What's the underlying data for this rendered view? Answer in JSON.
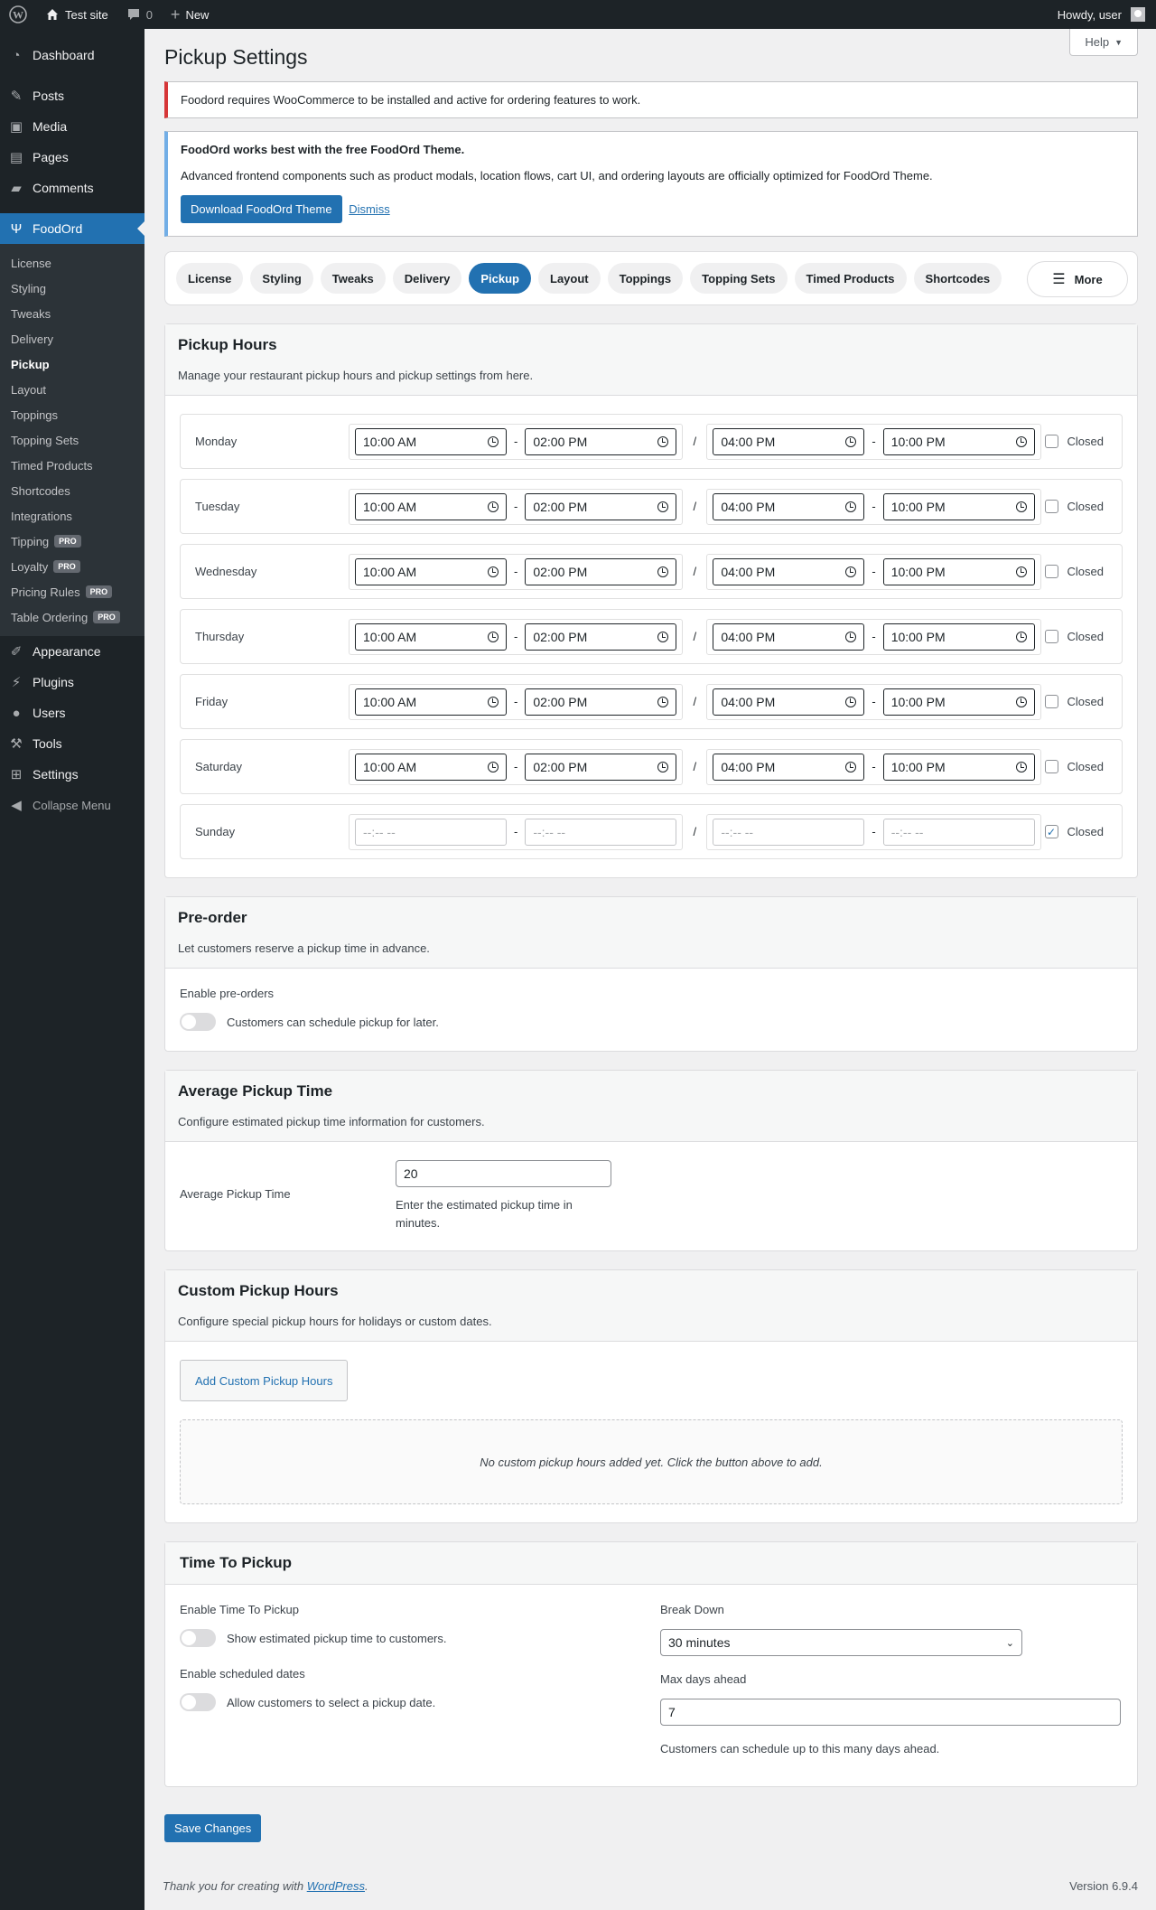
{
  "adminbar": {
    "site": "Test site",
    "comments": "0",
    "new": "New",
    "howdy": "Howdy, user"
  },
  "sidebar": {
    "dashboard": "Dashboard",
    "posts": "Posts",
    "media": "Media",
    "pages": "Pages",
    "comments": "Comments",
    "foodord": "FoodOrd",
    "submenu": [
      "License",
      "Styling",
      "Tweaks",
      "Delivery",
      "Pickup",
      "Layout",
      "Toppings",
      "Topping Sets",
      "Timed Products",
      "Shortcodes",
      "Integrations"
    ],
    "pro_items": [
      {
        "label": "Tipping",
        "badge": "PRO"
      },
      {
        "label": "Loyalty",
        "badge": "PRO"
      },
      {
        "label": "Pricing Rules",
        "badge": "PRO"
      },
      {
        "label": "Table Ordering",
        "badge": "PRO"
      }
    ],
    "appearance": "Appearance",
    "plugins": "Plugins",
    "users": "Users",
    "tools": "Tools",
    "settings": "Settings",
    "collapse": "Collapse Menu"
  },
  "help": "Help",
  "page_title": "Pickup Settings",
  "notice_error": "Foodord requires WooCommerce to be installed and active for ordering features to work.",
  "notice_info": {
    "title": "FoodOrd works best with the free FoodOrd Theme.",
    "text": "Advanced frontend components such as product modals, location flows, cart UI, and ordering layouts are officially optimized for FoodOrd Theme.",
    "button": "Download FoodOrd Theme",
    "dismiss": "Dismiss"
  },
  "tabs": [
    "License",
    "Styling",
    "Tweaks",
    "Delivery",
    "Pickup",
    "Layout",
    "Toppings",
    "Topping Sets",
    "Timed Products",
    "Shortcodes"
  ],
  "active_tab": "Pickup",
  "more": "More",
  "pickup_hours": {
    "title": "Pickup Hours",
    "desc": "Manage your restaurant pickup hours and pickup settings from here.",
    "closed_label": "Closed",
    "days": [
      {
        "name": "Monday",
        "s1": "10:00  AM",
        "e1": "02:00  PM",
        "s2": "04:00  PM",
        "e2": "10:00  PM",
        "closed": false
      },
      {
        "name": "Tuesday",
        "s1": "10:00  AM",
        "e1": "02:00  PM",
        "s2": "04:00  PM",
        "e2": "10:00  PM",
        "closed": false
      },
      {
        "name": "Wednesday",
        "s1": "10:00  AM",
        "e1": "02:00  PM",
        "s2": "04:00  PM",
        "e2": "10:00  PM",
        "closed": false
      },
      {
        "name": "Thursday",
        "s1": "10:00  AM",
        "e1": "02:00  PM",
        "s2": "04:00  PM",
        "e2": "10:00  PM",
        "closed": false
      },
      {
        "name": "Friday",
        "s1": "10:00  AM",
        "e1": "02:00  PM",
        "s2": "04:00  PM",
        "e2": "10:00  PM",
        "closed": false
      },
      {
        "name": "Saturday",
        "s1": "10:00  AM",
        "e1": "02:00  PM",
        "s2": "04:00  PM",
        "e2": "10:00  PM",
        "closed": false
      },
      {
        "name": "Sunday",
        "s1": "--:--  --",
        "e1": "--:--  --",
        "s2": "--:--  --",
        "e2": "--:--  --",
        "closed": true
      }
    ]
  },
  "preorder": {
    "title": "Pre-order",
    "desc": "Let customers reserve a pickup time in advance.",
    "label": "Enable pre-orders",
    "toggle_text": "Customers can schedule pickup for later.",
    "enabled": false
  },
  "avg_time": {
    "title": "Average Pickup Time",
    "desc": "Configure estimated pickup time information for customers.",
    "label": "Average Pickup Time",
    "value": "20",
    "help": "Enter the estimated pickup time in minutes."
  },
  "custom_hours": {
    "title": "Custom Pickup Hours",
    "desc": "Configure special pickup hours for holidays or custom dates.",
    "button": "Add Custom Pickup Hours",
    "empty": "No custom pickup hours added yet. Click the button above to add."
  },
  "time_to_pickup": {
    "title": "Time To Pickup",
    "enable_label": "Enable Time To Pickup",
    "enable_text": "Show estimated pickup time to customers.",
    "scheduled_label": "Enable scheduled dates",
    "scheduled_text": "Allow customers to select a pickup date.",
    "breakdown_label": "Break Down",
    "breakdown_value": "30 minutes",
    "maxdays_label": "Max days ahead",
    "maxdays_value": "7",
    "maxdays_help": "Customers can schedule up to this many days ahead."
  },
  "save": "Save Changes",
  "footer": {
    "thanks_prefix": "Thank you for creating with ",
    "wp_link": "WordPress",
    "thanks_suffix": ".",
    "version": "Version 6.9.4"
  },
  "colors": {
    "accent": "#2271b1",
    "error": "#d63638",
    "info": "#72aee6",
    "sidebar": "#1d2327"
  }
}
